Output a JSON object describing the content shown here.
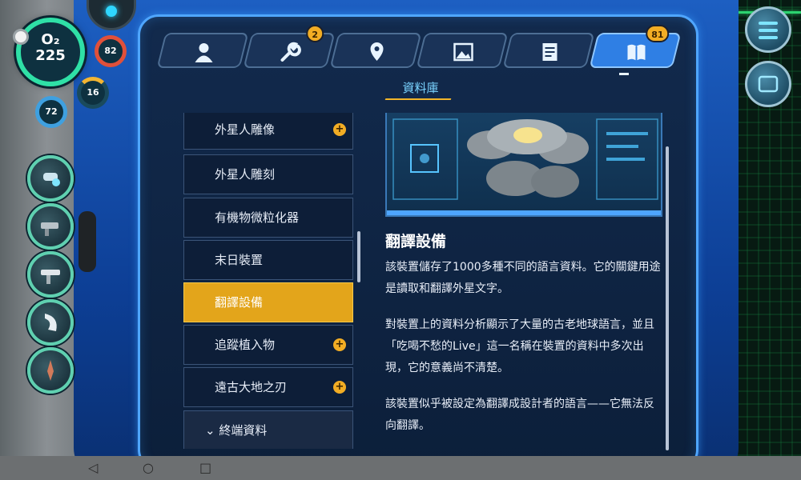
{
  "hud": {
    "oxygen_label": "O₂",
    "oxygen_value": "225",
    "health": "82",
    "food": "16",
    "water": "72"
  },
  "tabs": [
    {
      "icon": "player-icon",
      "badge": ""
    },
    {
      "icon": "wrench-icon",
      "badge": "2"
    },
    {
      "icon": "location-pin-icon",
      "badge": ""
    },
    {
      "icon": "gallery-icon",
      "badge": ""
    },
    {
      "icon": "notes-icon",
      "badge": ""
    },
    {
      "icon": "databank-book-icon",
      "badge": "81"
    }
  ],
  "section": {
    "title": "資料庫"
  },
  "list": [
    {
      "label": "外星人雕像",
      "new": true
    },
    {
      "label": "外星人雕刻",
      "new": false
    },
    {
      "label": "有機物微粒化器",
      "new": false
    },
    {
      "label": "末日裝置",
      "new": false
    },
    {
      "label": "翻譯設備",
      "new": false,
      "selected": true
    },
    {
      "label": "追蹤植入物",
      "new": true
    },
    {
      "label": "遠古大地之刃",
      "new": true
    },
    {
      "label": "終端資料",
      "folder": true
    }
  ],
  "detail": {
    "title": "翻譯設備",
    "paragraphs": [
      "該裝置儲存了1000多種不同的語言資料。它的關鍵用途是讀取和翻譯外星文字。",
      "對裝置上的資料分析顯示了大量的古老地球語言，並且「吃喝不愁的Live」這一名稱在裝置的資料中多次出現，它的意義尚不清楚。",
      "該裝置似乎被設定為翻譯成設計者的語言——它無法反向翻譯。"
    ]
  },
  "colors": {
    "accent": "#f2ad24",
    "panel_border": "#4fa6ff",
    "selected_item": "#e3a51b"
  }
}
